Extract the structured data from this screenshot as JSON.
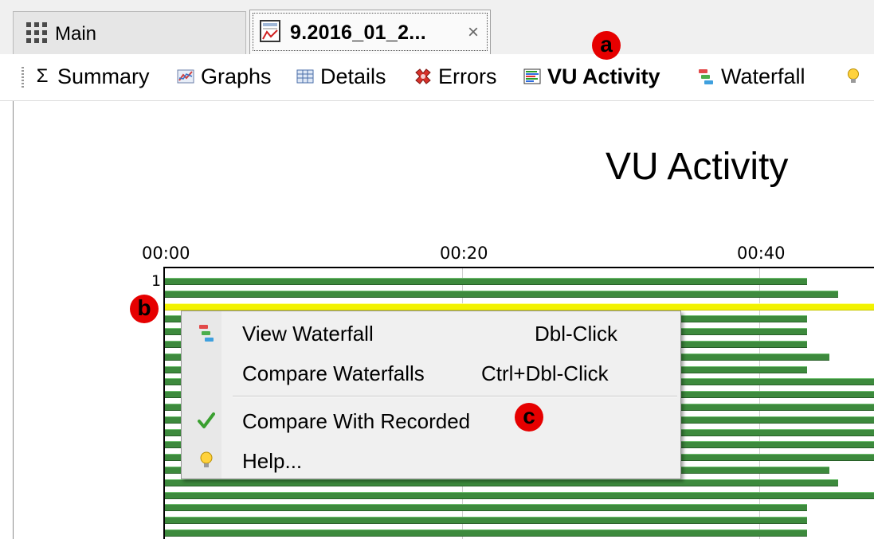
{
  "tabs": [
    {
      "label": "Main",
      "icon": "grid-icon"
    },
    {
      "label": "9.2016_01_2...",
      "icon": "report-icon",
      "close": "×"
    }
  ],
  "toolbar": {
    "items": [
      {
        "label": "Summary",
        "icon": "sigma-icon"
      },
      {
        "label": "Graphs",
        "icon": "graph-icon"
      },
      {
        "label": "Details",
        "icon": "table-icon"
      },
      {
        "label": "Errors",
        "icon": "errors-icon"
      },
      {
        "label": "VU Activity",
        "icon": "vu-activity-icon",
        "active": true
      },
      {
        "label": "Waterfall",
        "icon": "waterfall-icon"
      },
      {
        "label": "",
        "icon": "lightbulb-icon"
      }
    ]
  },
  "chart": {
    "title": "VU Activity",
    "row_label": "1",
    "ticks": [
      "00:00",
      "00:20",
      "00:40"
    ]
  },
  "chart_data": {
    "type": "bar",
    "title": "VU Activity",
    "x_ticks": [
      "00:00",
      "00:20",
      "00:40"
    ],
    "xlim_seconds": [
      0,
      48
    ],
    "bar_end_seconds": [
      43.2,
      45.3,
      48.0,
      43.2,
      43.2,
      43.2,
      44.7,
      43.2,
      48.0,
      48.0,
      48.0,
      48.0,
      48.0,
      48.0,
      48.0,
      44.7,
      45.3,
      48.0,
      43.2,
      43.2,
      43.2
    ],
    "highlighted_row_index": 2,
    "colors": {
      "bar": "#3d8a3d",
      "highlight": "#f2f200"
    }
  },
  "context_menu": {
    "items": [
      {
        "label": "View Waterfall",
        "shortcut": "Dbl-Click",
        "icon": "waterfall-icon"
      },
      {
        "label": "Compare Waterfalls",
        "shortcut": "Ctrl+Dbl-Click",
        "icon": ""
      },
      {
        "label": "Compare With Recorded",
        "shortcut": "",
        "icon": "checkmark-icon"
      },
      {
        "label": "Help...",
        "shortcut": "",
        "icon": "lightbulb-icon"
      }
    ]
  },
  "callouts": {
    "a": "a",
    "b": "b",
    "c": "c"
  }
}
